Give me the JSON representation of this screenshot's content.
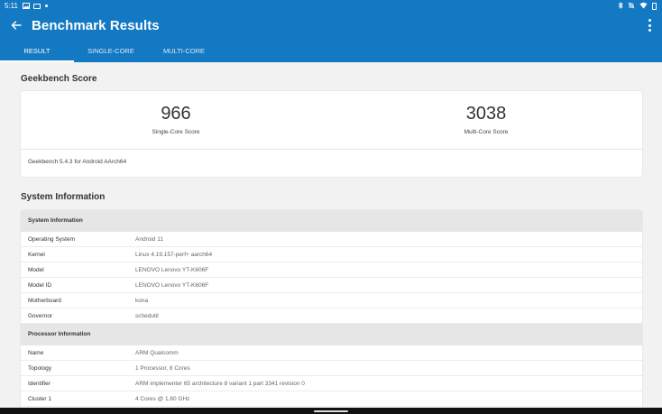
{
  "status_bar": {
    "time": "5:11",
    "left_icons": [
      "gallery-icon",
      "message-icon",
      "dot-icon"
    ],
    "right_icons": [
      "bluetooth-icon",
      "mute-icon",
      "wifi-icon",
      "battery-icon"
    ]
  },
  "app_bar": {
    "title": "Benchmark Results",
    "color": "#1479c3"
  },
  "tabs": [
    {
      "label": "RESULT",
      "active": true
    },
    {
      "label": "SINGLE-CORE",
      "active": false
    },
    {
      "label": "MULTI-CORE",
      "active": false
    }
  ],
  "geekbench_score": {
    "heading": "Geekbench Score",
    "single_core": {
      "value": "966",
      "label": "Single-Core Score"
    },
    "multi_core": {
      "value": "3038",
      "label": "Multi-Core Score"
    },
    "footer": "Geekbench 5.4.3 for Android AArch64"
  },
  "system_information": {
    "heading": "System Information",
    "groups": [
      {
        "title": "System Information",
        "rows": [
          {
            "key": "Operating System",
            "value": "Android 11"
          },
          {
            "key": "Kernel",
            "value": "Linux 4.19.157-perf+ aarch64"
          },
          {
            "key": "Model",
            "value": "LENOVO Lenovo YT-K606F"
          },
          {
            "key": "Model ID",
            "value": "LENOVO Lenovo YT-K606F"
          },
          {
            "key": "Motherboard",
            "value": "kona"
          },
          {
            "key": "Governor",
            "value": "schedutil"
          }
        ]
      },
      {
        "title": "Processor Information",
        "rows": [
          {
            "key": "Name",
            "value": "ARM Qualcomm"
          },
          {
            "key": "Topology",
            "value": "1 Processor, 8 Cores"
          },
          {
            "key": "Identifier",
            "value": "ARM implementer 65 architecture 8 variant 1 part 3341 revision 0"
          },
          {
            "key": "Cluster 1",
            "value": "4 Cores @ 1.80 GHz"
          }
        ]
      }
    ]
  }
}
